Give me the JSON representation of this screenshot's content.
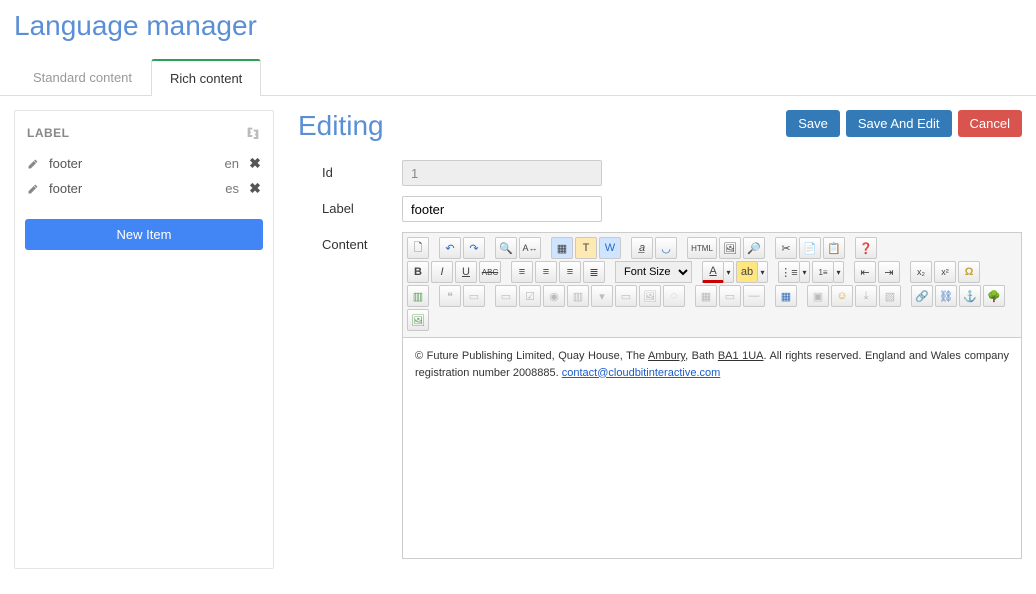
{
  "page_title": "Language manager",
  "tabs": [
    {
      "label": "Standard content",
      "active": false
    },
    {
      "label": "Rich content",
      "active": true
    }
  ],
  "sidebar": {
    "header": "LABEL",
    "items": [
      {
        "label": "footer",
        "lang": "en"
      },
      {
        "label": "footer",
        "lang": "es"
      }
    ],
    "new_item_label": "New Item"
  },
  "editor": {
    "title": "Editing",
    "buttons": {
      "save": "Save",
      "save_and_edit": "Save And Edit",
      "cancel": "Cancel"
    },
    "fields": {
      "id_label": "Id",
      "id_value": "1",
      "label_label": "Label",
      "label_value": "footer",
      "content_label": "Content"
    },
    "font_size_placeholder": "Font Size",
    "content_text_prefix": "© Future Publishing Limited, Quay House, The ",
    "content_text_ambury": "Ambury",
    "content_text_mid": ", Bath ",
    "content_text_postcode": "BA1 1UA",
    "content_text_after": ". All rights reserved. England and Wales company registration number 2008885. ",
    "content_email": "contact@cloudbitinteractive.com"
  }
}
